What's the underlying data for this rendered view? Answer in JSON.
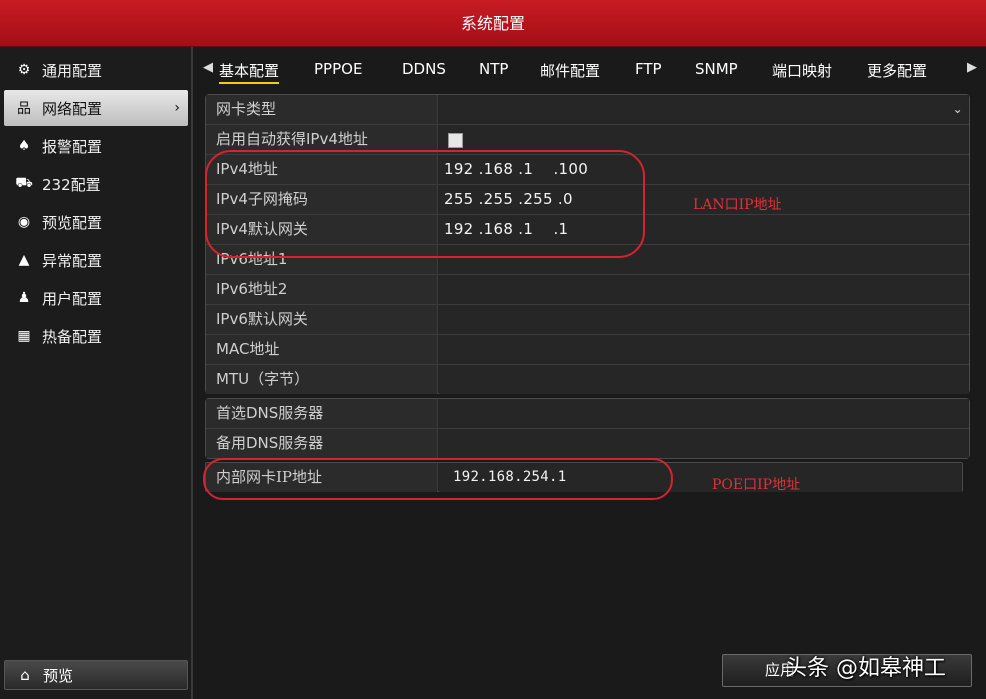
{
  "window": {
    "title": "系统配置"
  },
  "sidebar": {
    "items": [
      {
        "icon": "gear-icon",
        "glyph": "⚙",
        "label": "通用配置"
      },
      {
        "icon": "network-icon",
        "glyph": "品",
        "label": "网络配置",
        "active": true
      },
      {
        "icon": "alarm-icon",
        "glyph": "♠",
        "label": "报警配置"
      },
      {
        "icon": "serial-icon",
        "glyph": "⛟",
        "label": "232配置"
      },
      {
        "icon": "eye-icon",
        "glyph": "◉",
        "label": "预览配置"
      },
      {
        "icon": "warning-icon",
        "glyph": "▲",
        "label": "异常配置"
      },
      {
        "icon": "users-icon",
        "glyph": "👥",
        "label": "用户配置"
      },
      {
        "icon": "backup-icon",
        "glyph": "▦",
        "label": "热备配置"
      }
    ],
    "preview_label": "预览",
    "preview_icon": "home-icon",
    "active_chevron": "›"
  },
  "tabs": {
    "items": [
      "基本配置",
      "PPPOE",
      "DDNS",
      "NTP",
      "邮件配置",
      "FTP",
      "SNMP",
      "端口映射",
      "更多配置"
    ],
    "active_index": 0,
    "left_arrow": "◀",
    "right_arrow": "▶"
  },
  "form": {
    "nic_type": {
      "label": "网卡类型",
      "value": "",
      "chevron": "⌄"
    },
    "dhcp": {
      "label": "启用自动获得IPv4地址",
      "checked": false
    },
    "ipv4_address": {
      "label": "IPv4地址",
      "value": "192 .168 .1    .100"
    },
    "ipv4_mask": {
      "label": "IPv4子网掩码",
      "value": "255 .255 .255 .0"
    },
    "ipv4_gateway": {
      "label": "IPv4默认网关",
      "value": "192 .168 .1    .1"
    },
    "ipv6_address1": {
      "label": "IPv6地址1",
      "value": ""
    },
    "ipv6_address2": {
      "label": "IPv6地址2",
      "value": ""
    },
    "ipv6_gateway": {
      "label": "IPv6默认网关",
      "value": ""
    },
    "mac": {
      "label": "MAC地址",
      "value": ""
    },
    "mtu": {
      "label": "MTU（字节）",
      "value": ""
    },
    "dns_primary": {
      "label": "首选DNS服务器",
      "value": ""
    },
    "dns_secondary": {
      "label": "备用DNS服务器",
      "value": ""
    },
    "internal_nic": {
      "label": "内部网卡IP地址",
      "value": "192.168.254.1"
    }
  },
  "annotations": {
    "lan": "LAN口IP地址",
    "poe": "POE口IP地址",
    "color": "#d6232e"
  },
  "footer": {
    "apply_label": "应用"
  },
  "watermark": "头条 @如皋神工"
}
